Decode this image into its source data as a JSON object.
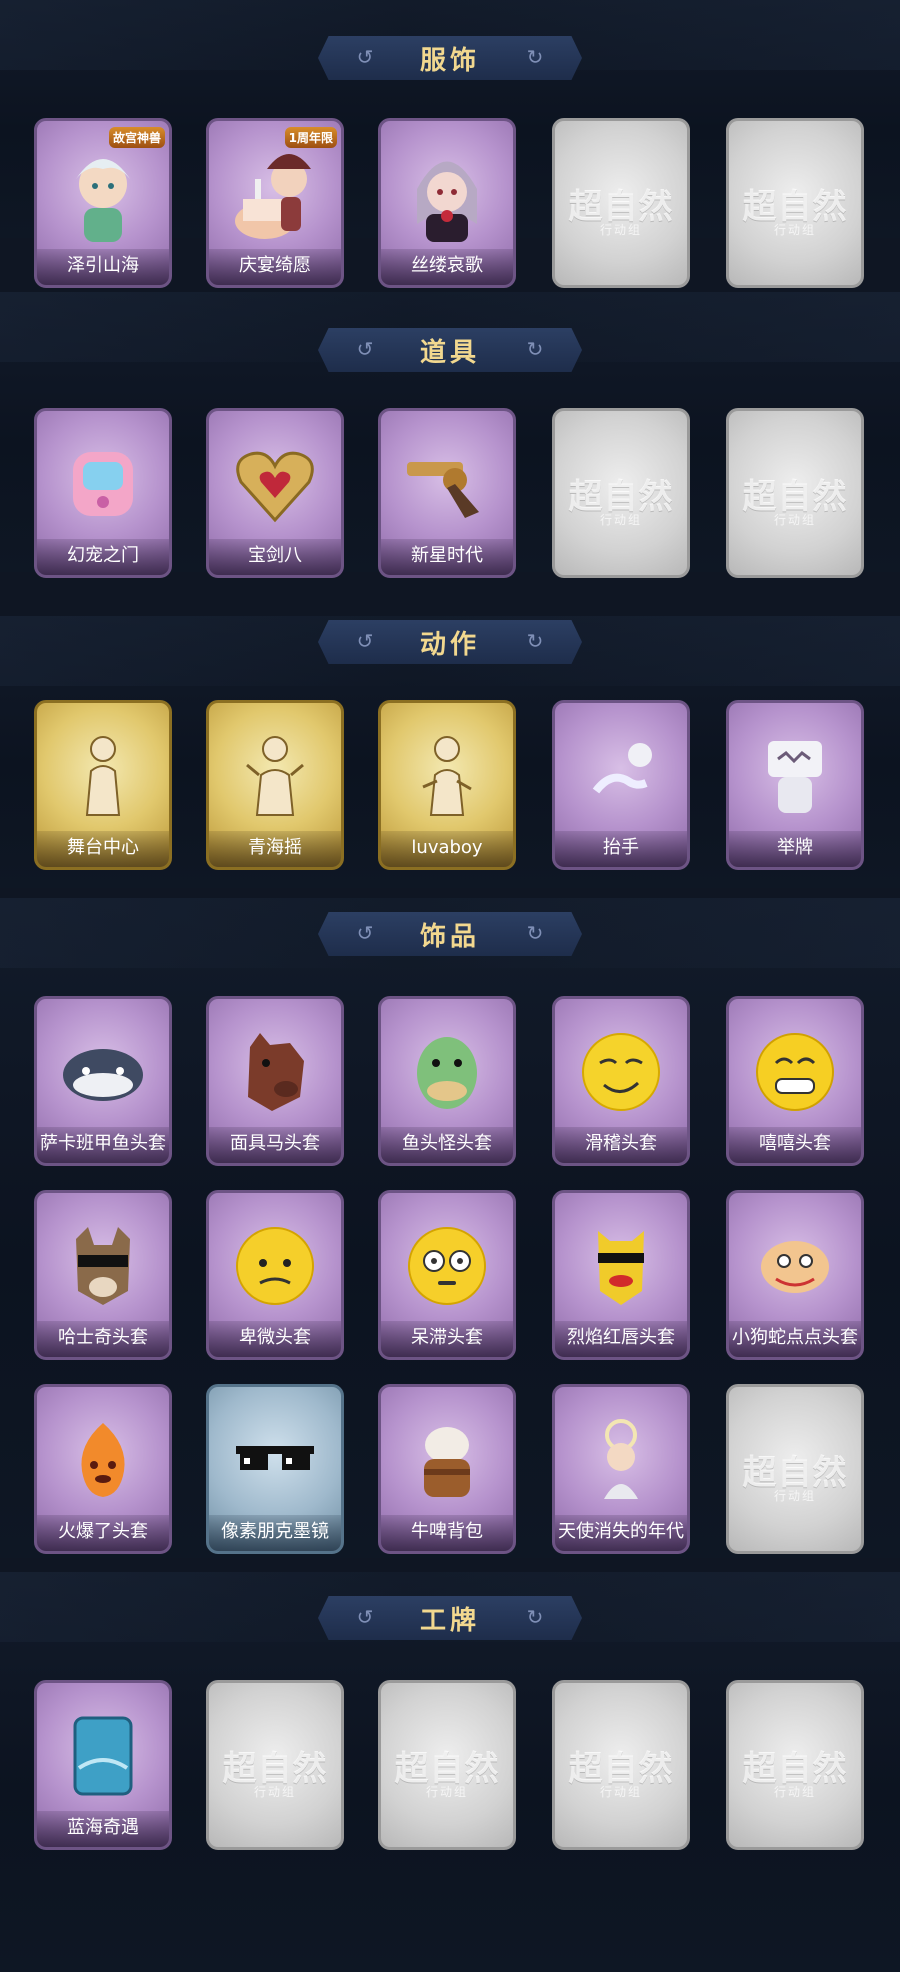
{
  "sections": [
    {
      "title": "服饰",
      "items": [
        "泽引山海",
        "庆宴绮愿",
        "丝缕哀歌"
      ]
    },
    {
      "title": "道具",
      "items": [
        "幻宠之门",
        "宝剑八",
        "新星时代"
      ]
    },
    {
      "title": "动作",
      "items": [
        "舞台中心",
        "青海摇",
        "luvaboy",
        "抬手",
        "举牌"
      ]
    },
    {
      "title": "饰品",
      "items": [
        "萨卡班甲鱼头套",
        "面具马头套",
        "鱼头怪头套",
        "滑稽头套",
        "嘻嘻头套",
        "哈士奇头套",
        "卑微头套",
        "呆滞头套",
        "烈焰红唇头套",
        "小狗蛇点点头套",
        "火爆了头套",
        "像素朋克墨镜",
        "牛啤背包",
        "天使消失的年代"
      ]
    },
    {
      "title": "工牌",
      "items": [
        "蓝海奇遇"
      ]
    }
  ],
  "badges": {
    "collab": "故宫神兽",
    "anniversary": "1周年限"
  },
  "empty_slot": {
    "logo": "超自然",
    "sub": "行动组"
  },
  "colors": {
    "bg": "#0f1623",
    "title": "#f2d88f",
    "purple": "#b693cd",
    "gold": "#e1c86d",
    "empty": "#d2d2d2"
  }
}
